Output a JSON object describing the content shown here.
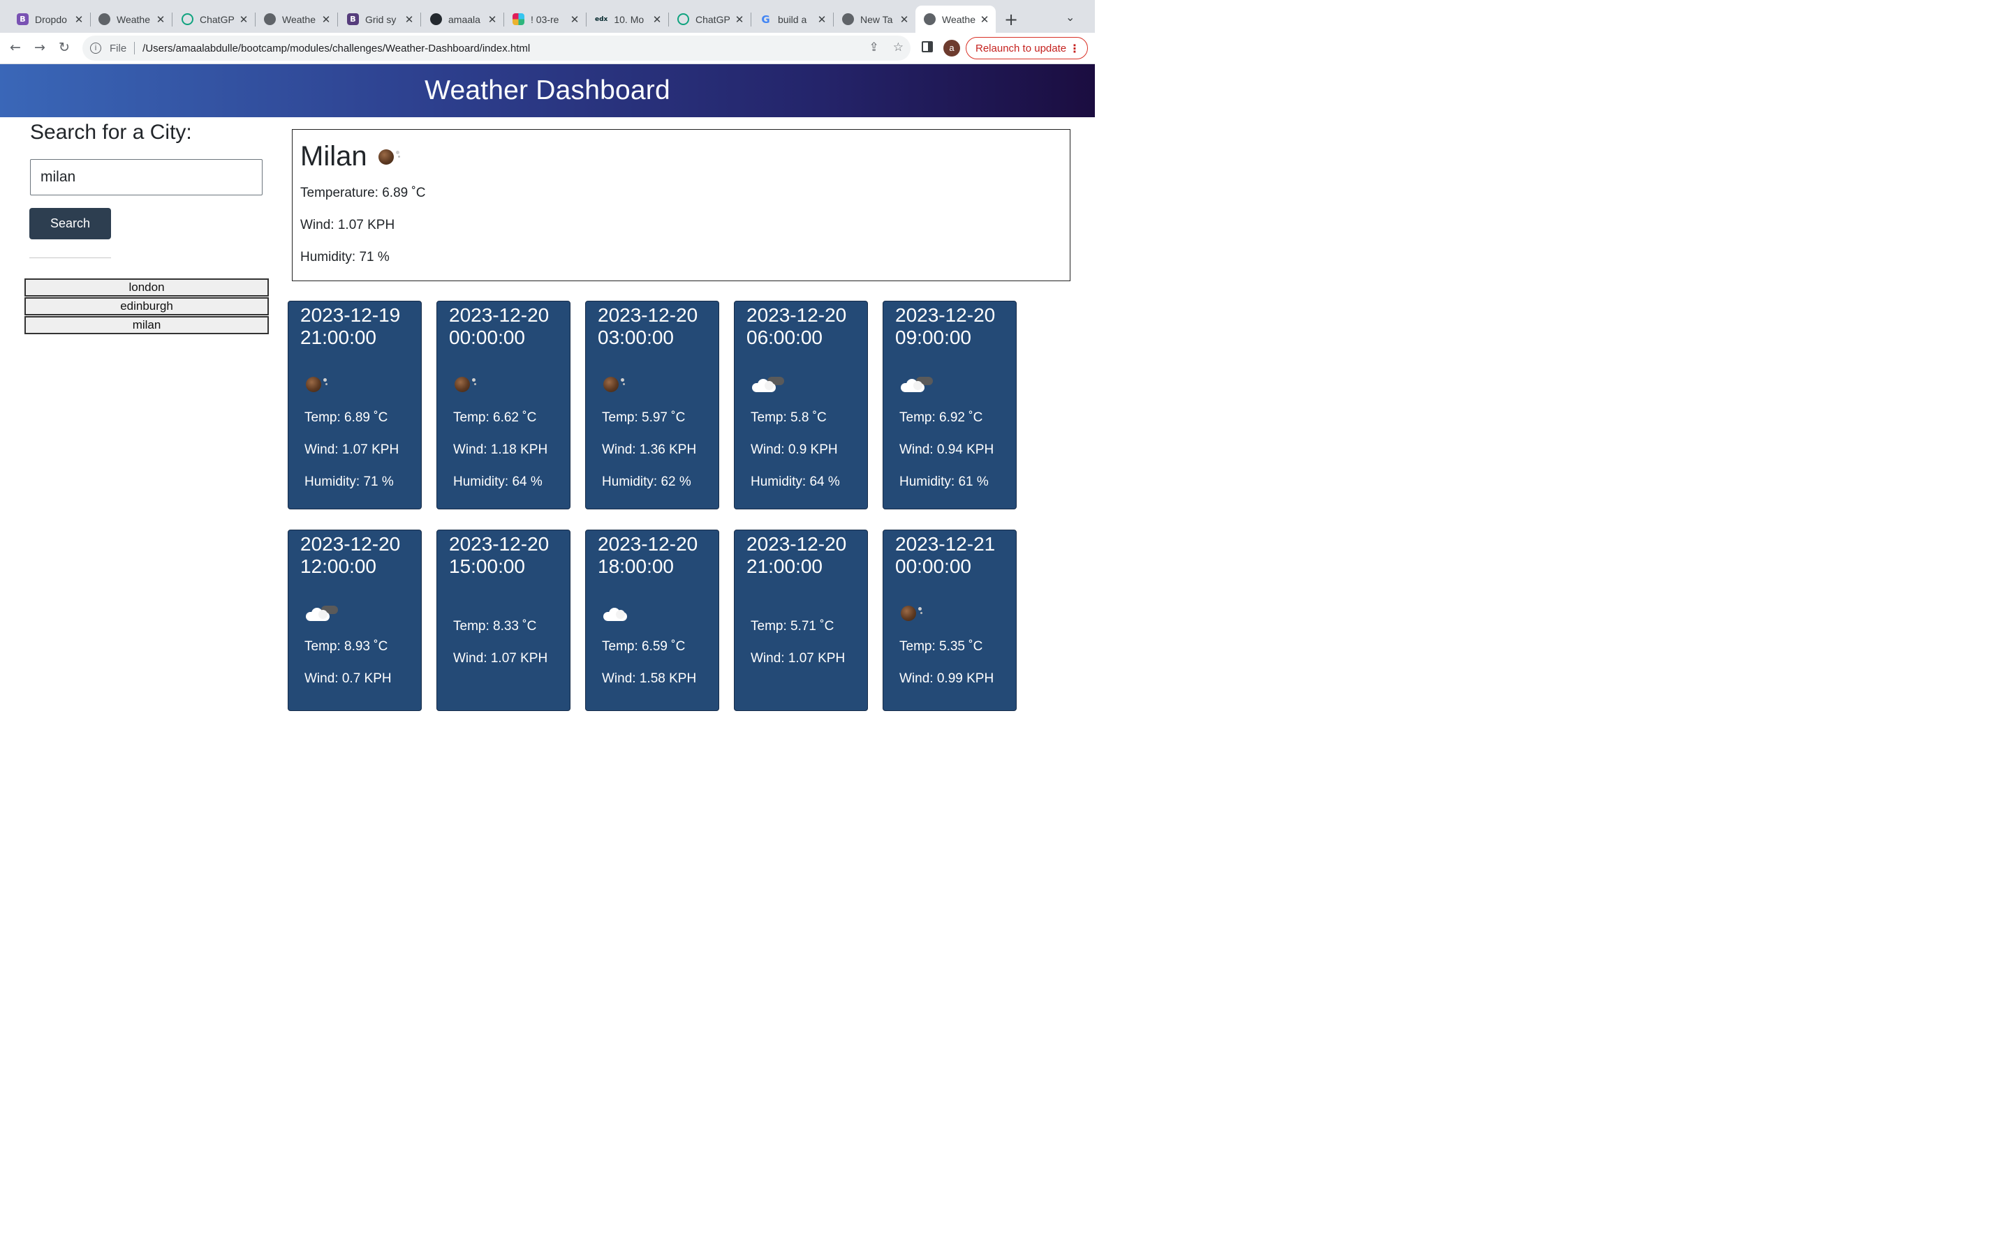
{
  "browser": {
    "tabs": [
      {
        "label": "Dropdo",
        "favicon": "bootstrap-icon",
        "color": "#7952b3",
        "glyph": "B"
      },
      {
        "label": "Weathe",
        "favicon": "globe-icon",
        "color": "#5f6368",
        "glyph": ""
      },
      {
        "label": "ChatGP",
        "favicon": "chatgpt-icon",
        "color": "#10a37f",
        "glyph": ""
      },
      {
        "label": "Weathe",
        "favicon": "globe-icon",
        "color": "#5f6368",
        "glyph": ""
      },
      {
        "label": "Grid sy",
        "favicon": "bootstrap-icon",
        "color": "#563d7c",
        "glyph": "B"
      },
      {
        "label": "amaala",
        "favicon": "github-icon",
        "color": "#24292f",
        "glyph": ""
      },
      {
        "label": "! 03-re",
        "favicon": "slack-icon",
        "color": "#e01e5a",
        "glyph": ""
      },
      {
        "label": "10. Mo",
        "favicon": "edx-icon",
        "color": "#02262b",
        "glyph": "edx"
      },
      {
        "label": "ChatGP",
        "favicon": "chatgpt-icon",
        "color": "#10a37f",
        "glyph": ""
      },
      {
        "label": "build a",
        "favicon": "google-icon",
        "color": "#4285f4",
        "glyph": "G"
      },
      {
        "label": "New Ta",
        "favicon": "chrome-icon",
        "color": "#5f6368",
        "glyph": ""
      },
      {
        "label": "Weathe",
        "favicon": "globe-icon",
        "color": "#5f6368",
        "glyph": "",
        "active": true
      }
    ],
    "url_scheme": "File",
    "url": "/Users/amaalabdulle/bootcamp/modules/challenges/Weather-Dashboard/index.html",
    "avatar_letter": "a",
    "relaunch_label": "Relaunch to update"
  },
  "header": {
    "title": "Weather Dashboard"
  },
  "search": {
    "heading": "Search for a City:",
    "input_value": "milan",
    "button_label": "Search",
    "history": [
      "london",
      "edinburgh",
      "milan"
    ]
  },
  "current": {
    "city": "Milan",
    "icon": "moon-icon",
    "temperature": "Temperature: 6.89 ˚C",
    "wind": "Wind: 1.07 KPH",
    "humidity": "Humidity: 71 %"
  },
  "forecast": [
    {
      "date": "2023-12-19 21:00:00",
      "icon": "moon",
      "temp": "Temp: 6.89 ˚C",
      "wind": "Wind: 1.07 KPH",
      "humidity": "Humidity: 71 %"
    },
    {
      "date": "2023-12-20 00:00:00",
      "icon": "moon",
      "temp": "Temp: 6.62 ˚C",
      "wind": "Wind: 1.18 KPH",
      "humidity": "Humidity: 64 %"
    },
    {
      "date": "2023-12-20 03:00:00",
      "icon": "moon",
      "temp": "Temp: 5.97 ˚C",
      "wind": "Wind: 1.36 KPH",
      "humidity": "Humidity: 62 %"
    },
    {
      "date": "2023-12-20 06:00:00",
      "icon": "cloud-night",
      "temp": "Temp: 5.8 ˚C",
      "wind": "Wind: 0.9 KPH",
      "humidity": "Humidity: 64 %"
    },
    {
      "date": "2023-12-20 09:00:00",
      "icon": "cloud-night",
      "temp": "Temp: 6.92 ˚C",
      "wind": "Wind: 0.94 KPH",
      "humidity": "Humidity: 61 %"
    },
    {
      "date": "2023-12-20 12:00:00",
      "icon": "cloud-night",
      "temp": "Temp: 8.93 ˚C",
      "wind": "Wind: 0.7 KPH",
      "humidity": ""
    },
    {
      "date": "2023-12-20 15:00:00",
      "icon": "",
      "temp": "Temp: 8.33 ˚C",
      "wind": "Wind: 1.07 KPH",
      "humidity": ""
    },
    {
      "date": "2023-12-20 18:00:00",
      "icon": "cloud",
      "temp": "Temp: 6.59 ˚C",
      "wind": "Wind: 1.58 KPH",
      "humidity": ""
    },
    {
      "date": "2023-12-20 21:00:00",
      "icon": "",
      "temp": "Temp: 5.71 ˚C",
      "wind": "Wind: 1.07 KPH",
      "humidity": ""
    },
    {
      "date": "2023-12-21 00:00:00",
      "icon": "moon",
      "temp": "Temp: 5.35 ˚C",
      "wind": "Wind: 0.99 KPH",
      "humidity": ""
    }
  ]
}
